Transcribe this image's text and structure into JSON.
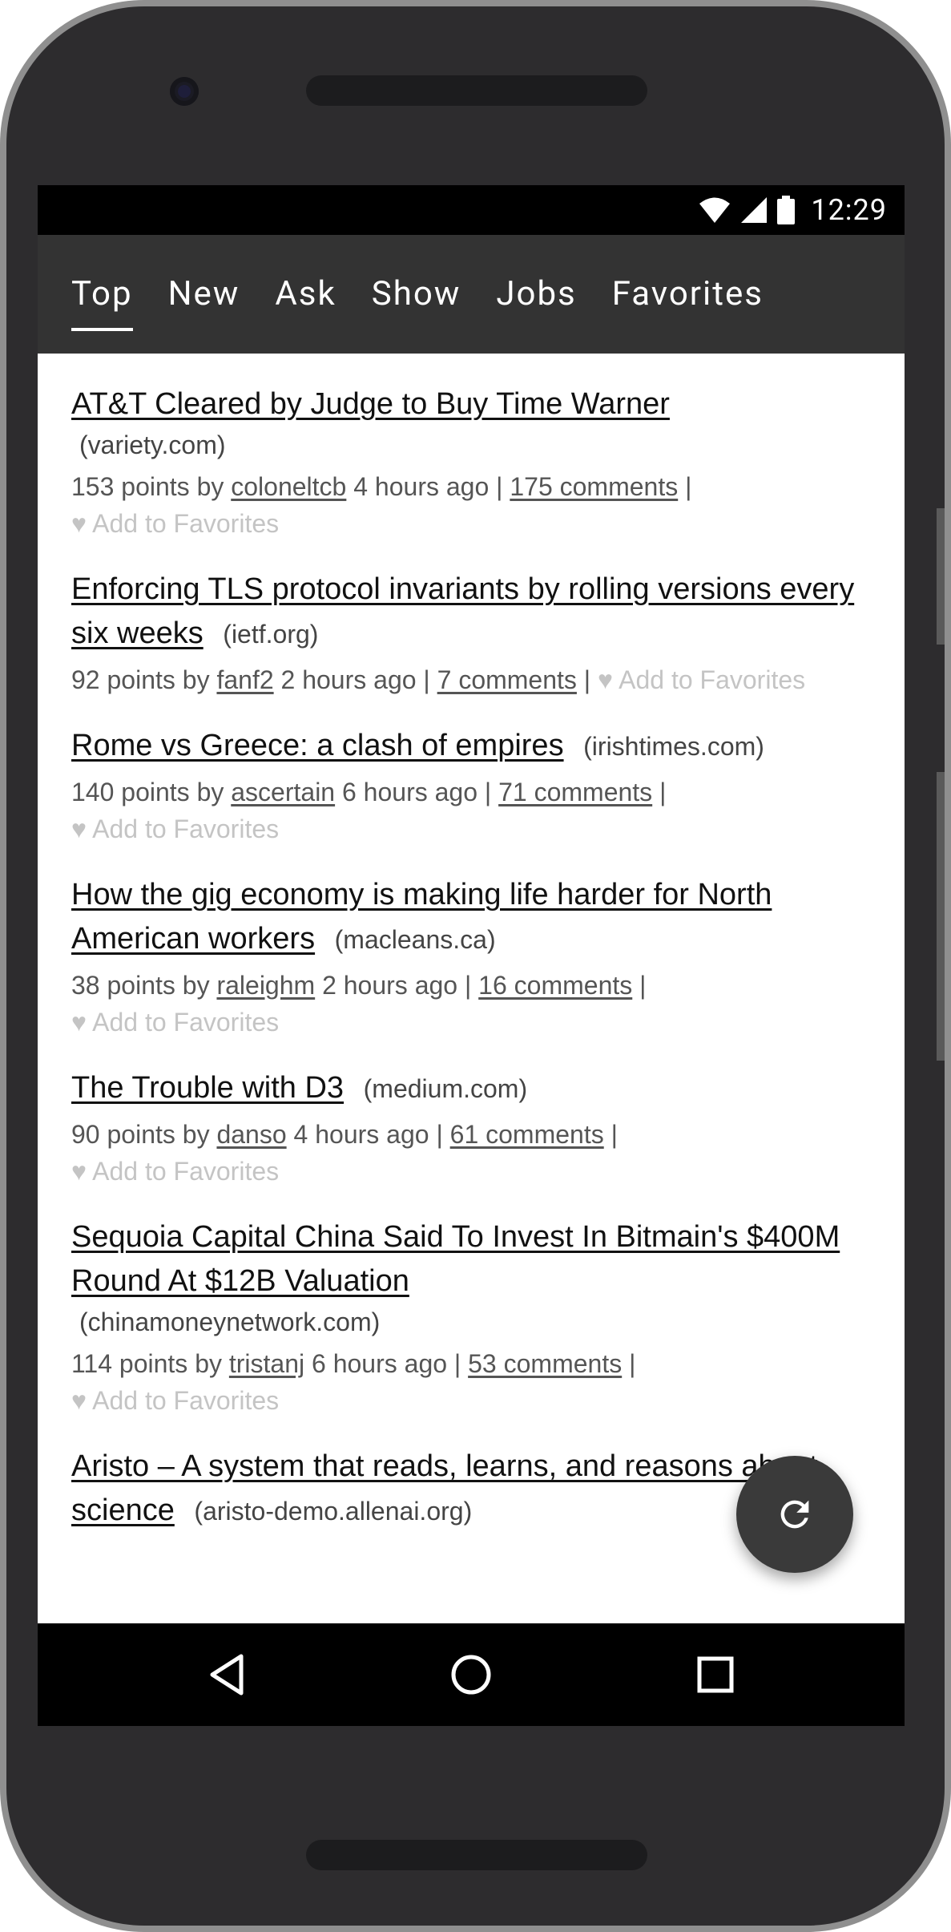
{
  "status_bar": {
    "time": "12:29",
    "icons": [
      "wifi-icon",
      "cell-signal-icon",
      "battery-icon"
    ]
  },
  "tabs": [
    {
      "label": "Top",
      "active": true
    },
    {
      "label": "New",
      "active": false
    },
    {
      "label": "Ask",
      "active": false
    },
    {
      "label": "Show",
      "active": false
    },
    {
      "label": "Jobs",
      "active": false
    },
    {
      "label": "Favorites",
      "active": false
    }
  ],
  "stories": [
    {
      "title": "AT&T Cleared by Judge to Buy Time Warner",
      "domain": "(variety.com)",
      "points": "153 points by",
      "user": "coloneltcb",
      "age": "4 hours ago |",
      "comments": "175 comments",
      "sep": "|",
      "fav": "♥ Add to Favorites"
    },
    {
      "title": "Enforcing TLS protocol invariants by rolling versions every six weeks",
      "domain": "(ietf.org)",
      "points": "92 points by",
      "user": "fanf2",
      "age": "2 hours ago |",
      "comments": "7 comments",
      "sep": "|",
      "fav": "♥ Add to Favorites"
    },
    {
      "title": "Rome vs Greece: a clash of empires",
      "domain": "(irishtimes.com)",
      "points": "140 points by",
      "user": "ascertain",
      "age": "6 hours ago |",
      "comments": "71 comments",
      "sep": "|",
      "fav": "♥ Add to Favorites"
    },
    {
      "title": "How the gig economy is making life harder for North American workers",
      "domain": "(macleans.ca)",
      "points": "38 points by",
      "user": "raleighm",
      "age": "2 hours ago |",
      "comments": "16 comments",
      "sep": "|",
      "fav": "♥ Add to Favorites"
    },
    {
      "title": "The Trouble with D3",
      "domain": "(medium.com)",
      "points": "90 points by",
      "user": "danso",
      "age": "4 hours ago |",
      "comments": "61 comments",
      "sep": "|",
      "fav": "♥ Add to Favorites"
    },
    {
      "title": "Sequoia Capital China Said To Invest In Bitmain's $400M Round At $12B Valuation",
      "domain": "(chinamoneynetwork.com)",
      "points": "114 points by",
      "user": "tristanj",
      "age": "6 hours ago |",
      "comments": "53 comments",
      "sep": "|",
      "fav": "♥ Add to Favorites"
    },
    {
      "title": "Aristo – A system that reads, learns, and reasons about science",
      "domain": "(aristo-demo.allenai.org)"
    }
  ],
  "fab": {
    "icon": "refresh-icon"
  },
  "nav": {
    "back": "back-icon",
    "home": "home-icon",
    "recents": "recents-icon"
  },
  "colors": {
    "tab_bar": "#333333",
    "bezel": "#2d2c2e",
    "muted_fav": "#c4c4c4"
  }
}
